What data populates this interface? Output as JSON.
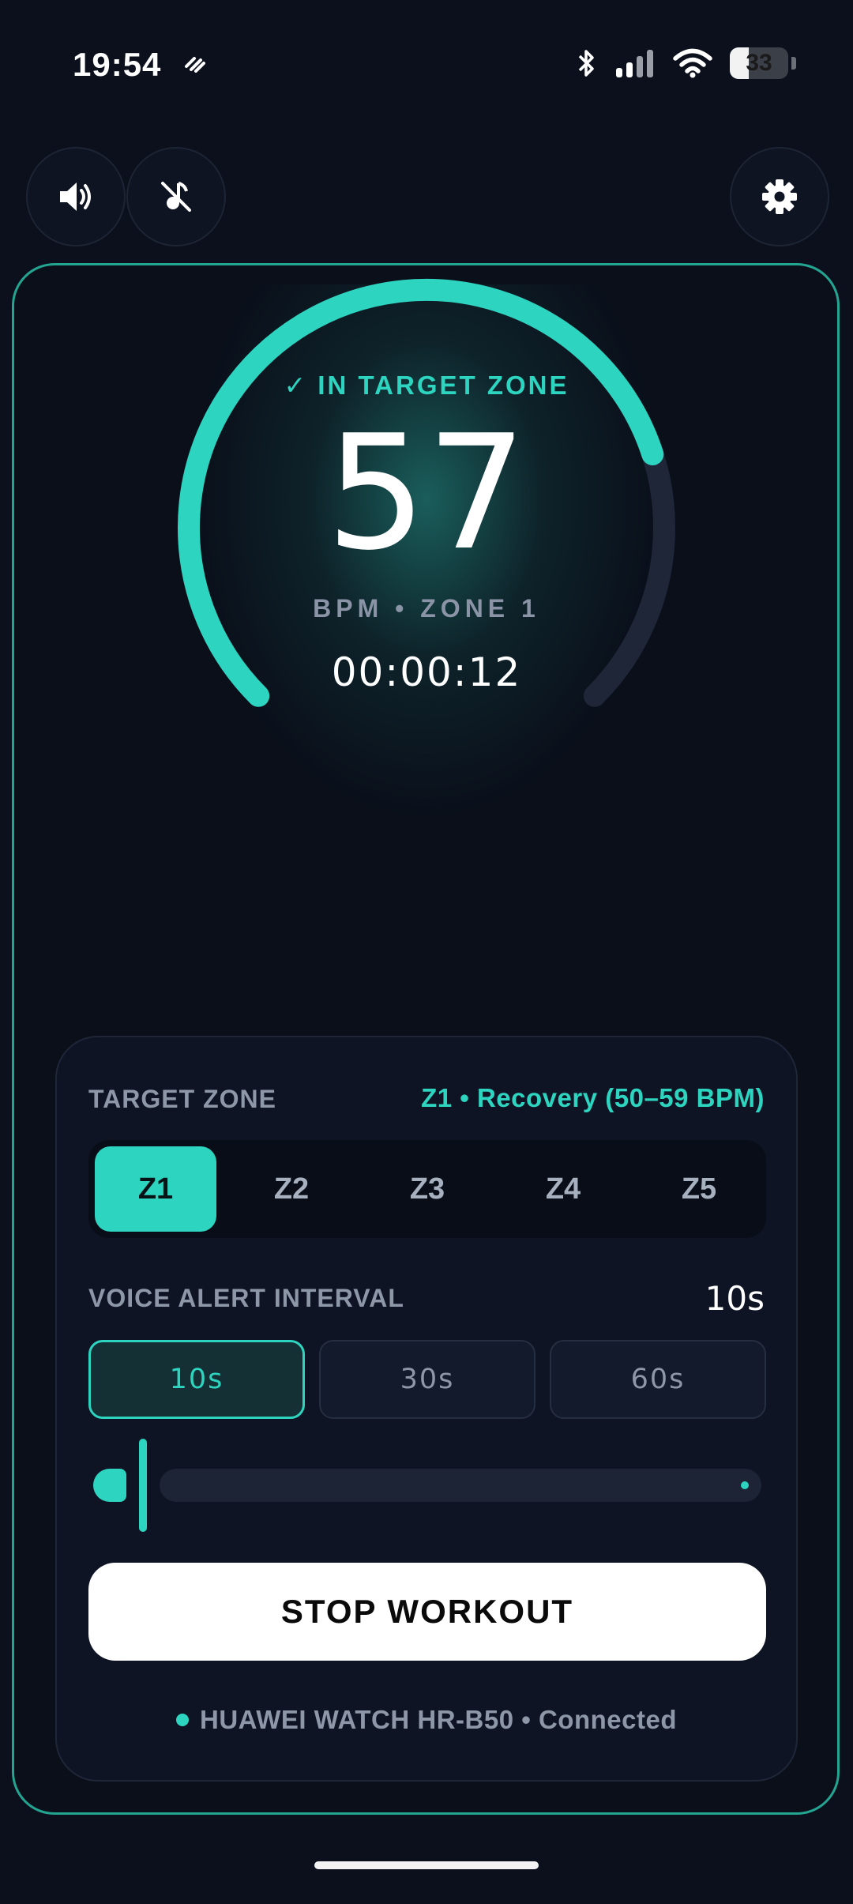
{
  "status_bar": {
    "time": "19:54",
    "battery_level": "33"
  },
  "controls": {
    "sound_icon": "speaker-icon",
    "mute_music_icon": "music-off-icon",
    "settings_icon": "gear-icon"
  },
  "gauge": {
    "zone_status": "✓ IN TARGET ZONE",
    "bpm": "57",
    "bpm_label": "BPM • ZONE 1",
    "elapsed": "00:00:12",
    "accent_color": "#2dd4bf"
  },
  "target_zone": {
    "label": "TARGET ZONE",
    "description": "Z1 • Recovery (50–59 BPM)",
    "zones": [
      "Z1",
      "Z2",
      "Z3",
      "Z4",
      "Z5"
    ],
    "selected": "Z1"
  },
  "voice_alert": {
    "label": "VOICE ALERT INTERVAL",
    "value": "10s",
    "options": [
      "10s",
      "30s",
      "60s"
    ],
    "selected": "10s",
    "slider_fraction": 0.0
  },
  "stop_button": {
    "label": "STOP WORKOUT"
  },
  "device": {
    "text": "HUAWEI WATCH HR-B50 • Connected"
  },
  "colors": {
    "background": "#0b101c",
    "accent": "#2dd4bf",
    "panel": "#0e1424"
  }
}
